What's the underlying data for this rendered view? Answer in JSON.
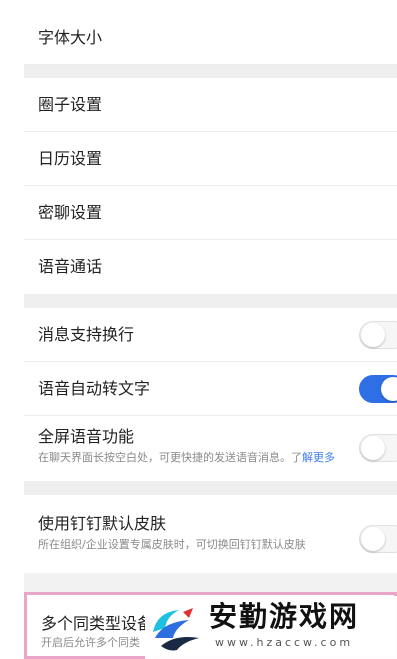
{
  "settings": {
    "font_size": "字体大小",
    "circle_settings": "圈子设置",
    "calendar_settings": "日历设置",
    "secret_chat_settings": "密聊设置",
    "voice_call": "语音通话",
    "message_line_wrap": {
      "label": "消息支持换行",
      "enabled": false
    },
    "voice_to_text": {
      "label": "语音自动转文字",
      "enabled": true
    },
    "fullscreen_voice": {
      "label": "全屏语音功能",
      "description": "在聊天界面长按空白处，可更快捷的发送语音消息。了",
      "more": "解更多",
      "enabled": false
    },
    "default_skin": {
      "label": "使用钉钉默认皮肤",
      "description": "所在组织/企业设置专属皮肤时，可切换回钉钉默认皮肤",
      "enabled": false
    },
    "multiple_devices": {
      "label": "多个同类型设备",
      "description": "开启后允许多个同类"
    }
  },
  "watermark": {
    "title": "安勤游戏网",
    "url": "www.hzaccw.com"
  },
  "colors": {
    "accent": "#2f6fe6",
    "highlight_border": "#e9a6c9"
  }
}
